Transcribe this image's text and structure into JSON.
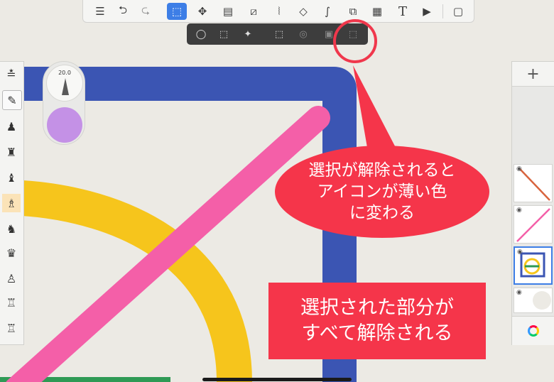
{
  "colors": {
    "canvas": "#eceae4",
    "blue_stroke": "#3b55b3",
    "yellow_stroke": "#f6c51c",
    "pink_stroke": "#f45fa8",
    "green_stroke": "#2f9a55",
    "brush_color": "#c491e6",
    "accent": "#3d7ee6",
    "annotation_red": "#f5354a"
  },
  "toolbar": {
    "icons": [
      "list-icon",
      "undo-icon",
      "redo-icon",
      "selection-icon",
      "transform-icon",
      "layer-icon",
      "ruler-icon",
      "symmetry-icon",
      "shape-icon",
      "curve-icon",
      "image-import-icon",
      "perspective-grid-icon",
      "text-icon",
      "video-icon",
      "fullscreen-icon"
    ],
    "text_glyph": "T"
  },
  "selection_bar": {
    "icons": [
      "lasso-select-icon",
      "rect-select-icon",
      "magic-wand-icon",
      "select-transform-icon",
      "select-invert-icon",
      "select-copy-icon",
      "clear-selection-icon"
    ]
  },
  "brush": {
    "size_value": "20.0"
  },
  "layers": {
    "add_label": "+"
  },
  "annotations": {
    "bubble_lines": [
      "選択が解除されると",
      "アイコンが薄い色",
      "に変わる"
    ],
    "box_lines": [
      "選択された部分が",
      "すべて解除される"
    ]
  }
}
